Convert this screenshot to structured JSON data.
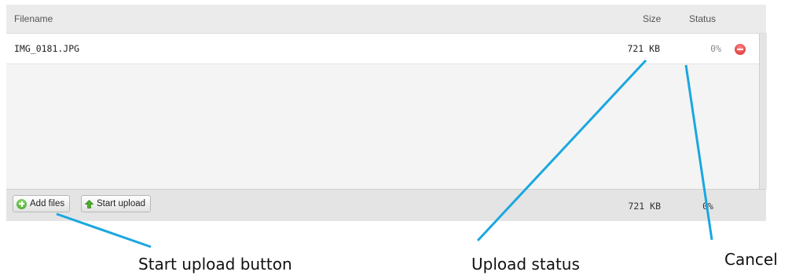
{
  "header": {
    "filename_label": "Filename",
    "size_label": "Size",
    "status_label": "Status"
  },
  "files": [
    {
      "name": "IMG_0181.JPG",
      "size": "721 KB",
      "status": "0%",
      "remove_icon": "remove-icon"
    }
  ],
  "footer": {
    "add_files_label": "Add files",
    "start_upload_label": "Start upload",
    "total_size": "721 KB",
    "total_percent": "0%"
  },
  "annotations": {
    "start_upload": "Start upload button",
    "upload_status": "Upload status",
    "cancel": "Cancel"
  },
  "colors": {
    "callout_line": "#1aa7e0",
    "remove_icon": "#d62323",
    "add_icon": "#3b9a25",
    "upload_arrow": "#4caf2a"
  }
}
